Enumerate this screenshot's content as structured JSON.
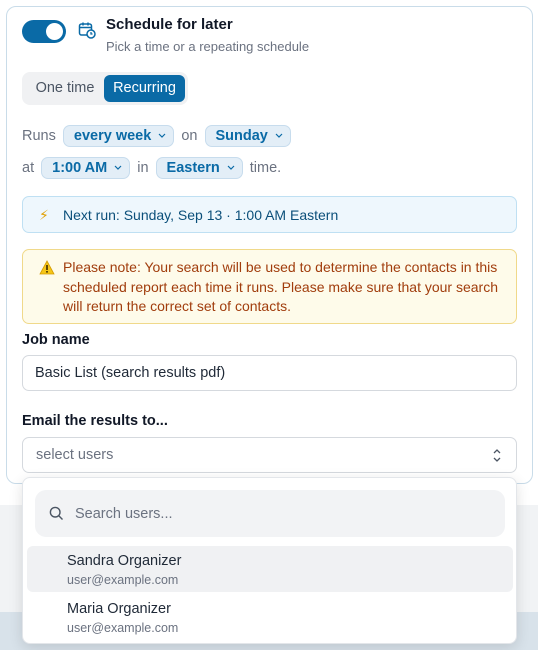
{
  "schedule": {
    "toggle_on": true,
    "title": "Schedule for later",
    "subtitle": "Pick a time or a repeating schedule"
  },
  "mode": {
    "options": [
      "One time",
      "Recurring"
    ],
    "selected": "Recurring"
  },
  "runs": {
    "prefix": "Runs",
    "frequency": "every week",
    "on_word": "on",
    "day": "Sunday",
    "at_word": "at",
    "time": "1:00 AM",
    "in_word": "in",
    "timezone": "Eastern",
    "suffix": "time."
  },
  "next_run": {
    "text": "Next run: Sunday, Sep 13 · 1:00 AM Eastern"
  },
  "warning": {
    "text": "Please note: Your search will be used to determine the contacts in this scheduled report each time it runs. Please make sure that your search will return the correct set of contacts."
  },
  "job_name": {
    "label": "Job name",
    "value": "Basic List (search results pdf)"
  },
  "email": {
    "label": "Email the results to...",
    "placeholder": "select users"
  },
  "dropdown": {
    "search_placeholder": "Search users...",
    "users": [
      {
        "name": "Sandra Organizer",
        "email": "user@example.com"
      },
      {
        "name": "Maria Organizer",
        "email": "user@example.com"
      }
    ]
  },
  "colors": {
    "accent": "#0a6aa6",
    "warning_text": "#a13d0d",
    "info_bg": "#eef7fd"
  }
}
